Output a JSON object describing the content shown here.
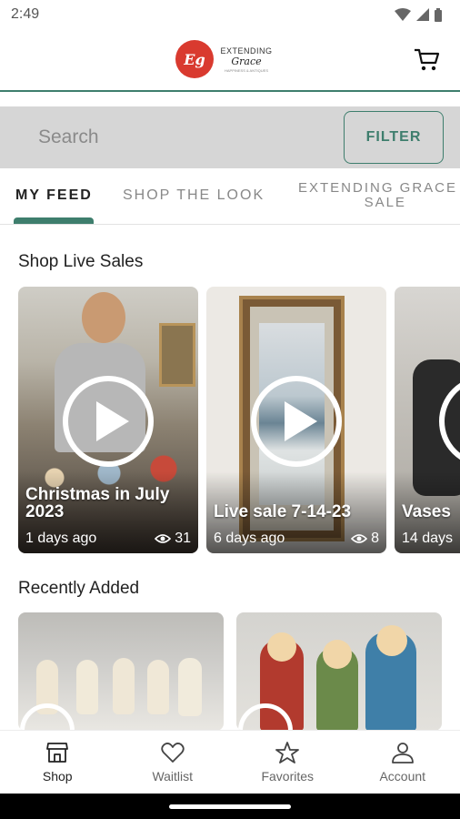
{
  "status_bar": {
    "time": "2:49"
  },
  "header": {
    "logo": {
      "mark": "Eg",
      "line1": "EXTENDING",
      "line2": "Grace",
      "line3": "HAPPINESS & ANTIQUES"
    },
    "cart_icon": "cart-icon"
  },
  "search": {
    "placeholder": "Search",
    "filter_label": "FILTER"
  },
  "tabs": [
    {
      "label": "MY FEED",
      "active": true
    },
    {
      "label": "SHOP THE LOOK",
      "active": false
    },
    {
      "label_line1": "EXTENDING GRACE L",
      "label_line2": "SALE",
      "active": false
    }
  ],
  "sections": {
    "live_sales_title": "Shop Live Sales",
    "recently_added_title": "Recently Added"
  },
  "live_sales": [
    {
      "title": "Christmas in July 2023",
      "age": "1 days ago",
      "views": "31"
    },
    {
      "title": "Live sale 7-14-23",
      "age": "6 days ago",
      "views": "8"
    },
    {
      "title": "Vases",
      "age": "14 days",
      "views": ""
    }
  ],
  "bottom_nav": [
    {
      "label": "Shop",
      "icon": "shop-icon",
      "active": true
    },
    {
      "label": "Waitlist",
      "icon": "heart-icon",
      "active": false
    },
    {
      "label": "Favorites",
      "icon": "star-icon",
      "active": false
    },
    {
      "label": "Account",
      "icon": "user-icon",
      "active": false
    }
  ],
  "colors": {
    "accent": "#3e7e6d",
    "logo_red": "#d93a2f",
    "search_bg": "#d6d6d6"
  }
}
